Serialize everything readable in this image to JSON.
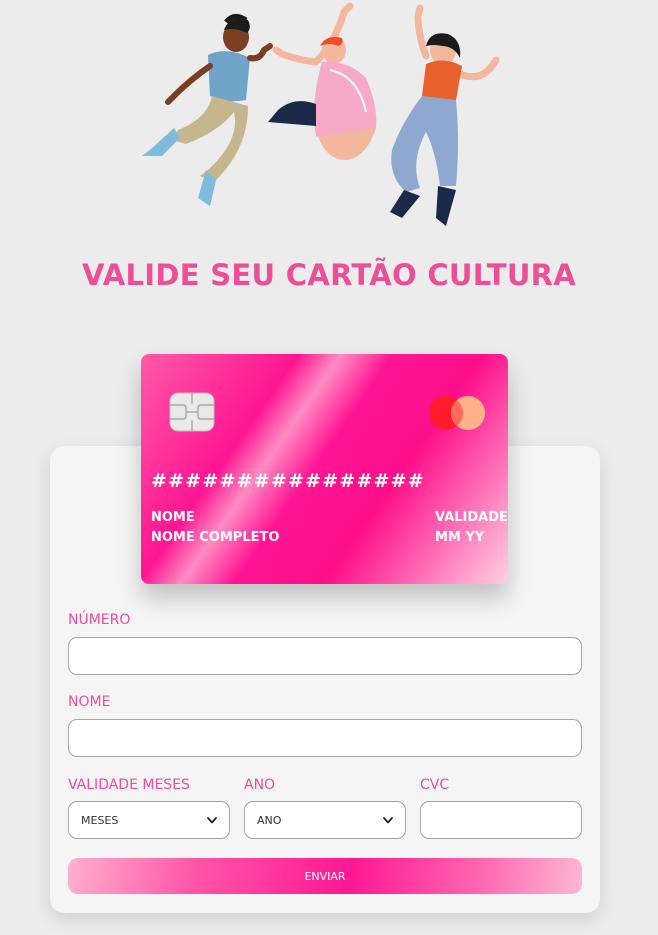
{
  "header": {
    "title": "VALIDE SEU CARTÃO CULTURA",
    "illustration": "people-jumping-illustration"
  },
  "card": {
    "number": "################",
    "name_label": "NOME",
    "name_value": "NOME COMPLETO",
    "expiry_label": "VALIDADE",
    "expiry_value": "MM YY",
    "chip_icon": "chip-icon",
    "brand_icon": "mastercard-logo-icon",
    "gradient_colors": [
      "#ff5aa6",
      "#ff1593",
      "#ffd1e2"
    ]
  },
  "form": {
    "number_label": "NÚMERO",
    "number_value": "",
    "name_label": "NOME",
    "name_value": "",
    "months_label": "VALIDADE MESES",
    "months_selected": "MESES",
    "year_label": "ANO",
    "year_selected": "ANO",
    "cvc_label": "CVC",
    "cvc_value": "",
    "submit_label": "ENVIAR"
  },
  "colors": {
    "accent": "#ec4f98",
    "background": "#ececec",
    "panel": "#f5f5f5"
  }
}
